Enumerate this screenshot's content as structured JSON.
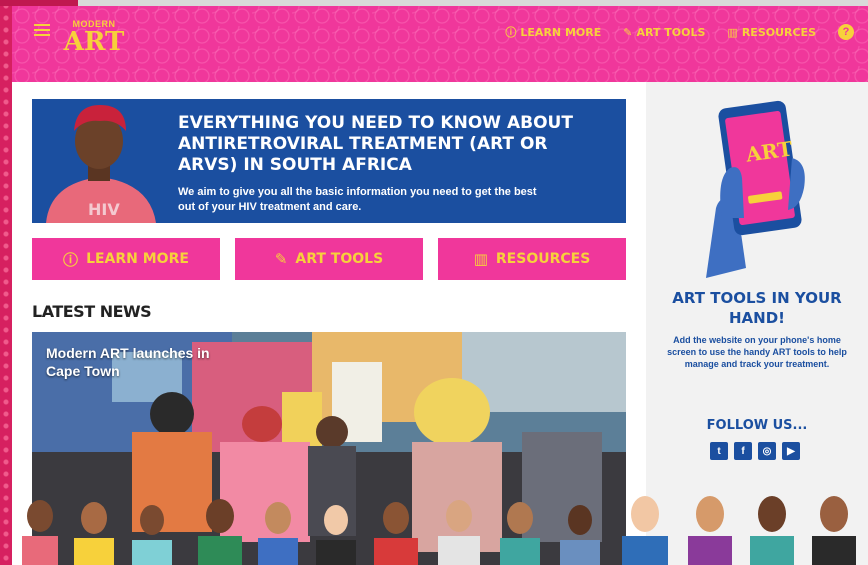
{
  "header": {
    "logo_line1": "MODERN",
    "logo_line2": "ART",
    "nav": [
      {
        "label": "LEARN MORE",
        "icon": "info-icon"
      },
      {
        "label": "ART TOOLS",
        "icon": "tools-icon"
      },
      {
        "label": "RESOURCES",
        "icon": "book-icon"
      }
    ],
    "help_icon": "?"
  },
  "hero": {
    "title": "EVERYTHING YOU NEED TO KNOW ABOUT ANTIRETROVIRAL TREATMENT (ART OR ARVs) IN SOUTH AFRICA",
    "text": "We aim to give you all the basic information you need to get the best out of your HIV treatment and care.",
    "shirt_text": "HIV"
  },
  "buttons": [
    {
      "label": "LEARN MORE",
      "icon": "info-icon"
    },
    {
      "label": "ART TOOLS",
      "icon": "tools-icon"
    },
    {
      "label": "RESOURCES",
      "icon": "book-icon"
    }
  ],
  "latest": {
    "heading": "LATEST NEWS",
    "card_title": "Modern ART launches in Cape Town"
  },
  "sidebar": {
    "phone_screen_title": "ART",
    "title": "ART TOOLS IN YOUR HAND!",
    "text": "Add the website on your phone's home screen to use the handy ART tools to help manage and track your treatment.",
    "follow": "FOLLOW US...",
    "socials": [
      "twitter-icon",
      "facebook-icon",
      "instagram-icon",
      "youtube-icon"
    ]
  },
  "colors": {
    "pink": "#f0379b",
    "yellow": "#f7d13b",
    "blue": "#1b4fa0"
  }
}
